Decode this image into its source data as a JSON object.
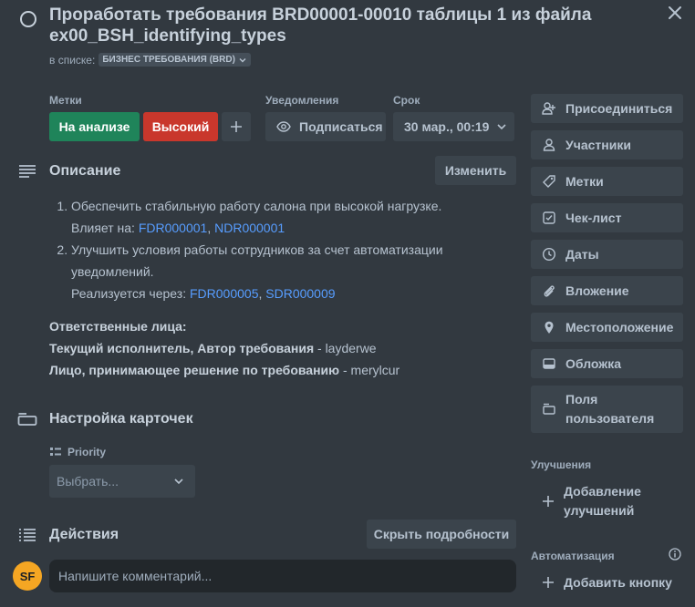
{
  "card": {
    "title": "Проработать требования BRD00001-00010 таблицы 1 из файла ex00_BSH_identifying_types",
    "list_prefix": "в списке:",
    "list_name": "БИЗНЕС ТРЕБОВАНИЯ (BRD)"
  },
  "fields": {
    "labels_heading": "Метки",
    "labels": [
      {
        "text": "На анализе",
        "color": "#1f845a"
      },
      {
        "text": "Высокий",
        "color": "#c9372c"
      }
    ],
    "notifications_heading": "Уведомления",
    "subscribe_label": "Подписаться",
    "due_heading": "Срок",
    "due_value": "30 мар., 00:19"
  },
  "description": {
    "heading": "Описание",
    "edit_label": "Изменить",
    "item1_text": "Обеспечить стабильную работу салона при высокой нагрузке.",
    "item1_affects": "Влияет на: ",
    "item1_link1": "FDR000001",
    "item1_sep": ", ",
    "item1_link2": "NDR000001",
    "item2_text": "Улучшить условия работы сотрудников за счет автоматизации уведомлений.",
    "item2_realized": "Реализуется через: ",
    "item2_link1": "FDR000005",
    "item2_sep": ", ",
    "item2_link2": "SDR000009",
    "responsible_heading": "Ответственные лица:",
    "executor_label": "Текущий исполнитель, Автор требования",
    "executor_value": " - layderwe",
    "decision_label": "Лицо, принимающее решение по требованию",
    "decision_value": " - merylcur"
  },
  "card_settings": {
    "heading": "Настройка карточек",
    "priority_label": "Priority",
    "select_placeholder": "Выбрать..."
  },
  "activity": {
    "heading": "Действия",
    "hide_details_label": "Скрыть подробности",
    "avatar_initials": "SF",
    "comment_placeholder": "Напишите комментарий..."
  },
  "sidebar": {
    "join": "Присоединиться",
    "members": "Участники",
    "labels": "Метки",
    "checklist": "Чек-лист",
    "dates": "Даты",
    "attachment": "Вложение",
    "location": "Местоположение",
    "cover": "Обложка",
    "custom_fields_line1": "Поля",
    "custom_fields_line2": "пользователя",
    "powerups_heading": "Улучшения",
    "add_powerups_line1": "Добавление",
    "add_powerups_line2": "улучшений",
    "automation_heading": "Автоматизация",
    "add_button": "Добавить кнопку"
  },
  "icons": [
    "close-icon",
    "person-plus-icon",
    "person-icon",
    "tag-icon",
    "checkbox-icon",
    "clock-icon",
    "paperclip-icon",
    "location-pin-icon",
    "cover-icon",
    "custom-fields-icon",
    "plus-icon",
    "info-icon",
    "eye-icon",
    "chevron-down-icon",
    "description-icon",
    "card-settings-icon",
    "activity-icon"
  ],
  "colors": {
    "background": "#323940",
    "link": "#579dff",
    "label_green": "#1f845a",
    "label_red": "#c9372c",
    "avatar": "#f5a623"
  }
}
